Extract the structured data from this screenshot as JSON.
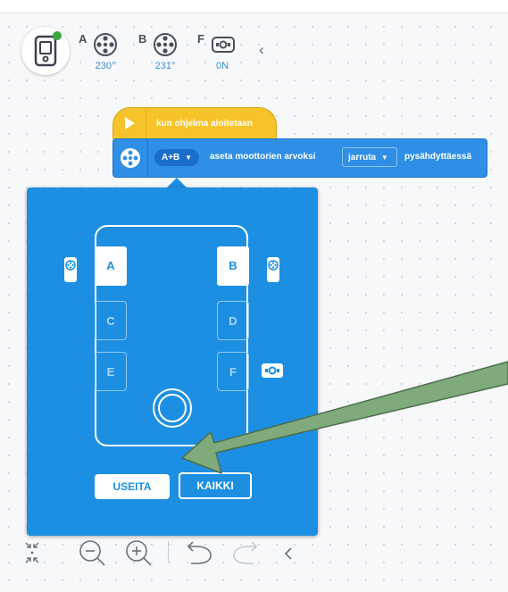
{
  "header": {
    "ports": [
      {
        "letter": "A",
        "value": "230°"
      },
      {
        "letter": "B",
        "value": "231°"
      },
      {
        "letter": "F",
        "value": "0N"
      }
    ],
    "collapse_glyph": "‹"
  },
  "blocks": {
    "start": {
      "label": "kun ohjelma aloitetaan"
    },
    "motor": {
      "ports_pill": "A+B",
      "text1": "aseta moottorien arvoksi",
      "dropdown": "jarruta",
      "text2": "pysähdyttäessä"
    }
  },
  "port_picker": {
    "slots": [
      {
        "letter": "A",
        "selected": true
      },
      {
        "letter": "B",
        "selected": true
      },
      {
        "letter": "C",
        "selected": false
      },
      {
        "letter": "D",
        "selected": false
      },
      {
        "letter": "E",
        "selected": false
      },
      {
        "letter": "F",
        "selected": false
      }
    ],
    "multiple_button": "USEITA",
    "all_button": "KAIKKI"
  },
  "colors": {
    "accent": "#1c8fe3",
    "event_yellow": "#f7c32a",
    "annotation_arrow": "#7eaa7c"
  },
  "toolbar": [
    "recenter-icon",
    "zoom-out-icon",
    "zoom-in-icon",
    "undo-icon",
    "redo-icon",
    "collapse-icon"
  ]
}
